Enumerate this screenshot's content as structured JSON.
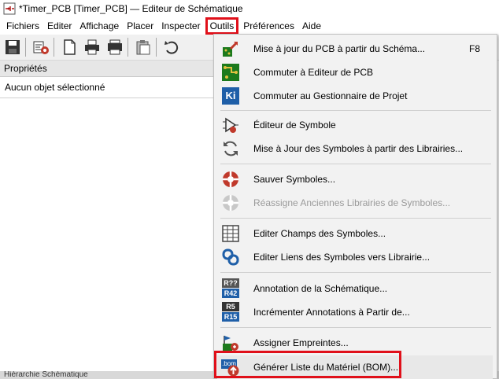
{
  "window": {
    "title": "*Timer_PCB [Timer_PCB] — Editeur de Schématique"
  },
  "menubar": {
    "items": [
      {
        "label": "Fichiers"
      },
      {
        "label": "Editer"
      },
      {
        "label": "Affichage"
      },
      {
        "label": "Placer"
      },
      {
        "label": "Inspecter"
      },
      {
        "label": "Outils",
        "open": true
      },
      {
        "label": "Préférences"
      },
      {
        "label": "Aide"
      }
    ]
  },
  "toolbar": {
    "icons": [
      "save-icon",
      "schematic-setup-icon",
      "page-setup-icon",
      "print-icon",
      "plot-icon",
      "paste-icon",
      "undo-icon"
    ]
  },
  "properties_panel": {
    "header": "Propriétés",
    "status": "Aucun objet sélectionné"
  },
  "bottom_strip": {
    "text": "Hiérarchie Schématique"
  },
  "tools_menu": {
    "items": [
      {
        "label": "Mise à jour du PCB à partir du  Schéma...",
        "shortcut": "F8",
        "icon": "update-pcb-icon"
      },
      {
        "label": "Commuter à Editeur de PCB",
        "icon": "pcb-editor-icon"
      },
      {
        "label": "Commuter au Gestionnaire de Projet",
        "icon": "kicad-icon"
      },
      {
        "label": "Éditeur de Symbole",
        "icon": "symbol-editor-icon"
      },
      {
        "label": "Mise à Jour des Symboles à partir des Librairies...",
        "icon": "refresh-icon"
      },
      {
        "label": "Sauver Symboles...",
        "icon": "save-symbols-icon"
      },
      {
        "label": "Réassigne Anciennes Librairies de Symboles...",
        "icon": "rescue-icon",
        "disabled": true
      },
      {
        "label": "Editer Champs des Symboles...",
        "icon": "table-icon"
      },
      {
        "label": "Editer Liens des Symboles vers Librairie...",
        "icon": "link-icon"
      },
      {
        "label": "Annotation de la Schématique...",
        "icon": "annotate-icon"
      },
      {
        "label": "Incrémenter Annotations à Partir de...",
        "icon": "increment-annotation-icon"
      },
      {
        "label": "Assigner Empreintes...",
        "icon": "footprint-icon"
      },
      {
        "label": "Générer Liste du Matériel (BOM)...",
        "icon": "bom-icon",
        "highlighted": true
      }
    ]
  },
  "icon_texts": {
    "ki": "Ki",
    "r_old_1": "R??",
    "r_new_1": "R42",
    "r_old_2": "R5",
    "r_new_2": "R15",
    "bom": ".bom"
  },
  "colors": {
    "highlight": "#e0101a",
    "kicad_blue": "#1f5fa8",
    "pcb_green": "#1c7a1c"
  }
}
